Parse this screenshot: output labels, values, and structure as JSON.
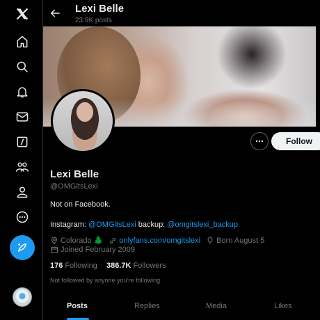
{
  "nav": {
    "items": [
      {
        "icon": "x-logo-icon"
      },
      {
        "icon": "home-icon"
      },
      {
        "icon": "search-icon"
      },
      {
        "icon": "notifications-bell-icon"
      },
      {
        "icon": "messages-envelope-icon"
      },
      {
        "icon": "grok-icon"
      },
      {
        "icon": "communities-icon"
      },
      {
        "icon": "profile-icon"
      },
      {
        "icon": "more-circle-icon"
      }
    ],
    "compose_icon": "compose-post-icon",
    "account_avatar_icon": "account-avatar"
  },
  "header": {
    "name": "Lexi Belle",
    "post_count": "23.9K posts"
  },
  "profile": {
    "display_name": "Lexi Belle",
    "handle": "@OMGitsLexi",
    "follow_label": "Follow",
    "bio_line1": "Not on Facebook.",
    "bio_line2_prefix": "Instagram: ",
    "bio_line2_link1": "@OMGitsLexi",
    "bio_line2_mid": " backup: ",
    "bio_line2_link2": "@omgitslexi_backup",
    "location": "Colorado",
    "location_emoji": "🌲",
    "website": "onlyfans.com/omgitslexi",
    "birthday": "Born August 5",
    "joined": "Joined February 2009",
    "following_count": "176",
    "following_label": "Following",
    "followers_count": "386.7K",
    "followers_label": "Followers",
    "not_followed_text": "Not followed by anyone you’re following"
  },
  "tabs": [
    {
      "label": "Posts",
      "active": true
    },
    {
      "label": "Replies",
      "active": false
    },
    {
      "label": "Media",
      "active": false
    },
    {
      "label": "Likes",
      "active": false
    }
  ],
  "colors": {
    "accent": "#1d9bf0",
    "background": "#000000",
    "text_primary": "#e7e9ea",
    "text_secondary": "#71767b"
  }
}
